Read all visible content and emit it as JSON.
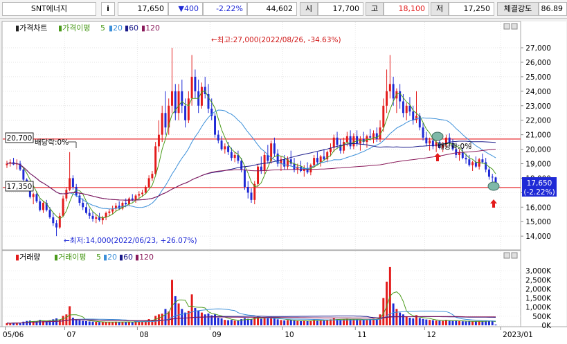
{
  "toolbar": {
    "stock_name": "SNT에너지",
    "info_icon": "i",
    "current_price": "17,650",
    "change": "▼400",
    "change_pct": "-2.22%",
    "volume": "44,602",
    "open_label": "시",
    "open": "17,700",
    "high_label": "고",
    "high": "18,100",
    "low_label": "저",
    "low": "17,250",
    "strength_label": "체결강도",
    "strength": "86.89"
  },
  "colors": {
    "up": "#e31b1b",
    "down": "#1f2ad6",
    "ma5": "#4a9a1a",
    "ma20": "#3b8fd9",
    "ma60": "#1a1a8a",
    "ma120": "#8a1a5a",
    "hline": "#e8292c",
    "background": "#ffffff"
  },
  "price_panel": {
    "legend": {
      "name": "가격차트",
      "ma_title": "가격이평",
      "ma": [
        "5",
        "20",
        "60",
        "120"
      ]
    },
    "high_annotation": "←최고:27,000(2022/08/26, -34.63%)",
    "low_annotation": "←최저:14,000(2022/06/23, +26.07%)",
    "dividend_label_1": "배당락:0%",
    "dividend_label_2": "배당락:0%",
    "level_high": "20,700",
    "level_low": "17,350",
    "current_badge_price": "17,650",
    "current_badge_pct": "(-2.22%)"
  },
  "volume_panel": {
    "legend": {
      "name": "거래량",
      "ma_title": "거래이평",
      "ma": [
        "5",
        "20",
        "60",
        "120"
      ]
    }
  },
  "x_axis": {
    "labels": [
      "05/06",
      "07",
      "08",
      "09",
      "10",
      "11",
      "12",
      "2023/01"
    ]
  },
  "chart_data": {
    "type": "candlestick",
    "price_axis": {
      "ylim": [
        13100,
        28100
      ],
      "ticks": [
        "14,000",
        "15,000",
        "16,000",
        "17,000",
        "18,000",
        "19,000",
        "20,000",
        "21,000",
        "22,000",
        "23,000",
        "24,000",
        "25,000",
        "26,000",
        "27,000"
      ]
    },
    "volume_axis": {
      "ylim": [
        0,
        3500
      ],
      "ticks": [
        "0K",
        "500K",
        "1,000K",
        "1,500K",
        "2,000K",
        "2,500K",
        "3,000K"
      ]
    },
    "horizontal_levels": [
      20700,
      17350
    ],
    "highest": {
      "value": 27000,
      "date": "2022/08/26"
    },
    "lowest": {
      "value": 14000,
      "date": "2022/06/23"
    },
    "month_starts": [
      0,
      18,
      40,
      62,
      84,
      106,
      127,
      150
    ],
    "candles": [
      {
        "o": 18900,
        "h": 19200,
        "l": 18700,
        "c": 19000,
        "v": 120
      },
      {
        "o": 19000,
        "h": 19300,
        "l": 18800,
        "c": 19100,
        "v": 110
      },
      {
        "o": 19100,
        "h": 19400,
        "l": 18900,
        "c": 18950,
        "v": 130
      },
      {
        "o": 18950,
        "h": 19300,
        "l": 18600,
        "c": 19000,
        "v": 150
      },
      {
        "o": 19000,
        "h": 19200,
        "l": 18500,
        "c": 18600,
        "v": 140
      },
      {
        "o": 18600,
        "h": 18700,
        "l": 17800,
        "c": 17900,
        "v": 200
      },
      {
        "o": 17900,
        "h": 18000,
        "l": 17200,
        "c": 17300,
        "v": 240
      },
      {
        "o": 17300,
        "h": 17400,
        "l": 16600,
        "c": 16700,
        "v": 260
      },
      {
        "o": 16700,
        "h": 17000,
        "l": 16200,
        "c": 16900,
        "v": 220
      },
      {
        "o": 16900,
        "h": 17100,
        "l": 16300,
        "c": 16400,
        "v": 210
      },
      {
        "o": 16400,
        "h": 16600,
        "l": 15700,
        "c": 15800,
        "v": 300
      },
      {
        "o": 15800,
        "h": 16400,
        "l": 15600,
        "c": 16300,
        "v": 260
      },
      {
        "o": 16300,
        "h": 16500,
        "l": 15700,
        "c": 15800,
        "v": 230
      },
      {
        "o": 15800,
        "h": 16000,
        "l": 15200,
        "c": 15300,
        "v": 280
      },
      {
        "o": 15300,
        "h": 15600,
        "l": 14700,
        "c": 14900,
        "v": 330
      },
      {
        "o": 14900,
        "h": 15100,
        "l": 14000,
        "c": 14600,
        "v": 380
      },
      {
        "o": 14600,
        "h": 15600,
        "l": 14500,
        "c": 15400,
        "v": 310
      },
      {
        "o": 15400,
        "h": 16800,
        "l": 15300,
        "c": 16600,
        "v": 520
      },
      {
        "o": 16600,
        "h": 17400,
        "l": 16400,
        "c": 17200,
        "v": 600
      },
      {
        "o": 17200,
        "h": 19800,
        "l": 17100,
        "c": 18000,
        "v": 1050
      },
      {
        "o": 18000,
        "h": 18200,
        "l": 17200,
        "c": 17400,
        "v": 420
      },
      {
        "o": 17400,
        "h": 17600,
        "l": 16700,
        "c": 16800,
        "v": 300
      },
      {
        "o": 16800,
        "h": 17000,
        "l": 16100,
        "c": 16300,
        "v": 280
      },
      {
        "o": 16300,
        "h": 16600,
        "l": 15800,
        "c": 16000,
        "v": 250
      },
      {
        "o": 16000,
        "h": 16300,
        "l": 15500,
        "c": 15600,
        "v": 230
      },
      {
        "o": 15600,
        "h": 15900,
        "l": 15200,
        "c": 15400,
        "v": 210
      },
      {
        "o": 15400,
        "h": 15700,
        "l": 15000,
        "c": 15200,
        "v": 200
      },
      {
        "o": 15200,
        "h": 15500,
        "l": 14900,
        "c": 15300,
        "v": 190
      },
      {
        "o": 15300,
        "h": 15600,
        "l": 15000,
        "c": 15100,
        "v": 180
      },
      {
        "o": 15100,
        "h": 15400,
        "l": 14800,
        "c": 15300,
        "v": 170
      },
      {
        "o": 15300,
        "h": 15700,
        "l": 15100,
        "c": 15600,
        "v": 180
      },
      {
        "o": 15600,
        "h": 15900,
        "l": 15400,
        "c": 15700,
        "v": 170
      },
      {
        "o": 15700,
        "h": 16100,
        "l": 15500,
        "c": 15900,
        "v": 190
      },
      {
        "o": 15900,
        "h": 16300,
        "l": 15700,
        "c": 16100,
        "v": 200
      },
      {
        "o": 16100,
        "h": 16400,
        "l": 15800,
        "c": 15900,
        "v": 180
      },
      {
        "o": 15900,
        "h": 16400,
        "l": 15800,
        "c": 16300,
        "v": 190
      },
      {
        "o": 16300,
        "h": 16600,
        "l": 16000,
        "c": 16200,
        "v": 180
      },
      {
        "o": 16200,
        "h": 16700,
        "l": 16100,
        "c": 16600,
        "v": 200
      },
      {
        "o": 16600,
        "h": 16900,
        "l": 16400,
        "c": 16500,
        "v": 190
      },
      {
        "o": 16500,
        "h": 16900,
        "l": 16300,
        "c": 16800,
        "v": 200
      },
      {
        "o": 16800,
        "h": 17100,
        "l": 16600,
        "c": 16900,
        "v": 210
      },
      {
        "o": 16900,
        "h": 17200,
        "l": 16700,
        "c": 17000,
        "v": 220
      },
      {
        "o": 17000,
        "h": 17500,
        "l": 16900,
        "c": 17400,
        "v": 260
      },
      {
        "o": 17400,
        "h": 18200,
        "l": 17300,
        "c": 18000,
        "v": 340
      },
      {
        "o": 18000,
        "h": 18500,
        "l": 17800,
        "c": 18300,
        "v": 300
      },
      {
        "o": 18300,
        "h": 20500,
        "l": 18200,
        "c": 20200,
        "v": 520
      },
      {
        "o": 20200,
        "h": 22000,
        "l": 19800,
        "c": 21000,
        "v": 600
      },
      {
        "o": 21000,
        "h": 23000,
        "l": 20500,
        "c": 22500,
        "v": 640
      },
      {
        "o": 22500,
        "h": 24000,
        "l": 21000,
        "c": 21500,
        "v": 900
      },
      {
        "o": 21500,
        "h": 23500,
        "l": 21000,
        "c": 23000,
        "v": 760
      },
      {
        "o": 23000,
        "h": 27000,
        "l": 22500,
        "c": 24000,
        "v": 2500
      },
      {
        "o": 24000,
        "h": 24500,
        "l": 22000,
        "c": 22500,
        "v": 1600
      },
      {
        "o": 22500,
        "h": 24500,
        "l": 22000,
        "c": 24000,
        "v": 1200
      },
      {
        "o": 24000,
        "h": 24800,
        "l": 22500,
        "c": 23000,
        "v": 900
      },
      {
        "o": 23000,
        "h": 23500,
        "l": 21500,
        "c": 22000,
        "v": 700
      },
      {
        "o": 22000,
        "h": 24000,
        "l": 21800,
        "c": 23500,
        "v": 800
      },
      {
        "o": 23500,
        "h": 26500,
        "l": 23000,
        "c": 25000,
        "v": 1700
      },
      {
        "o": 25000,
        "h": 25500,
        "l": 23500,
        "c": 24000,
        "v": 950
      },
      {
        "o": 24000,
        "h": 24800,
        "l": 22500,
        "c": 23000,
        "v": 800
      },
      {
        "o": 23000,
        "h": 24600,
        "l": 22800,
        "c": 24300,
        "v": 700
      },
      {
        "o": 24300,
        "h": 25000,
        "l": 23500,
        "c": 23800,
        "v": 600
      },
      {
        "o": 23800,
        "h": 24500,
        "l": 22500,
        "c": 22800,
        "v": 650
      },
      {
        "o": 22800,
        "h": 23500,
        "l": 22000,
        "c": 22300,
        "v": 550
      },
      {
        "o": 22300,
        "h": 22500,
        "l": 20800,
        "c": 21000,
        "v": 600
      },
      {
        "o": 21000,
        "h": 21300,
        "l": 20400,
        "c": 20600,
        "v": 420
      },
      {
        "o": 20600,
        "h": 20900,
        "l": 19900,
        "c": 20000,
        "v": 380
      },
      {
        "o": 20000,
        "h": 20400,
        "l": 19700,
        "c": 20200,
        "v": 300
      },
      {
        "o": 20200,
        "h": 20500,
        "l": 19600,
        "c": 19800,
        "v": 280
      },
      {
        "o": 19800,
        "h": 20100,
        "l": 19200,
        "c": 19400,
        "v": 300
      },
      {
        "o": 19400,
        "h": 19800,
        "l": 19100,
        "c": 19600,
        "v": 260
      },
      {
        "o": 19600,
        "h": 19900,
        "l": 19000,
        "c": 19200,
        "v": 250
      },
      {
        "o": 19200,
        "h": 19400,
        "l": 18400,
        "c": 18600,
        "v": 340
      },
      {
        "o": 18600,
        "h": 18800,
        "l": 17200,
        "c": 17400,
        "v": 400
      },
      {
        "o": 17400,
        "h": 17800,
        "l": 16600,
        "c": 17000,
        "v": 360
      },
      {
        "o": 17000,
        "h": 17300,
        "l": 16300,
        "c": 16500,
        "v": 330
      },
      {
        "o": 16500,
        "h": 17800,
        "l": 16200,
        "c": 17600,
        "v": 420
      },
      {
        "o": 17600,
        "h": 19000,
        "l": 17400,
        "c": 18800,
        "v": 480
      },
      {
        "o": 18800,
        "h": 19500,
        "l": 18300,
        "c": 18500,
        "v": 360
      },
      {
        "o": 18500,
        "h": 19800,
        "l": 18300,
        "c": 19600,
        "v": 420
      },
      {
        "o": 19600,
        "h": 20300,
        "l": 19000,
        "c": 19200,
        "v": 380
      },
      {
        "o": 19200,
        "h": 20600,
        "l": 19000,
        "c": 20400,
        "v": 460
      },
      {
        "o": 20400,
        "h": 20800,
        "l": 19500,
        "c": 19700,
        "v": 380
      },
      {
        "o": 19700,
        "h": 20000,
        "l": 18800,
        "c": 19000,
        "v": 330
      },
      {
        "o": 19000,
        "h": 19500,
        "l": 18500,
        "c": 19300,
        "v": 290
      },
      {
        "o": 19300,
        "h": 19600,
        "l": 18600,
        "c": 18800,
        "v": 270
      },
      {
        "o": 18800,
        "h": 19500,
        "l": 18600,
        "c": 19300,
        "v": 280
      },
      {
        "o": 19300,
        "h": 19900,
        "l": 18800,
        "c": 19000,
        "v": 300
      },
      {
        "o": 19000,
        "h": 19400,
        "l": 18400,
        "c": 18600,
        "v": 260
      },
      {
        "o": 18600,
        "h": 19000,
        "l": 18300,
        "c": 18800,
        "v": 240
      },
      {
        "o": 18800,
        "h": 19200,
        "l": 18400,
        "c": 18500,
        "v": 230
      },
      {
        "o": 18500,
        "h": 18900,
        "l": 18100,
        "c": 18700,
        "v": 250
      },
      {
        "o": 18700,
        "h": 19100,
        "l": 18300,
        "c": 18400,
        "v": 240
      },
      {
        "o": 18400,
        "h": 19000,
        "l": 18200,
        "c": 18900,
        "v": 260
      },
      {
        "o": 18900,
        "h": 19600,
        "l": 18700,
        "c": 19400,
        "v": 300
      },
      {
        "o": 19400,
        "h": 19800,
        "l": 18900,
        "c": 19100,
        "v": 280
      },
      {
        "o": 19100,
        "h": 19600,
        "l": 18800,
        "c": 19500,
        "v": 270
      },
      {
        "o": 19500,
        "h": 20000,
        "l": 19200,
        "c": 19300,
        "v": 260
      },
      {
        "o": 19300,
        "h": 19900,
        "l": 19100,
        "c": 19800,
        "v": 290
      },
      {
        "o": 19800,
        "h": 20400,
        "l": 19500,
        "c": 20100,
        "v": 330
      },
      {
        "o": 20100,
        "h": 21000,
        "l": 19800,
        "c": 20800,
        "v": 380
      },
      {
        "o": 20800,
        "h": 21200,
        "l": 20100,
        "c": 20300,
        "v": 340
      },
      {
        "o": 20300,
        "h": 20700,
        "l": 19700,
        "c": 19900,
        "v": 300
      },
      {
        "o": 19900,
        "h": 20800,
        "l": 19700,
        "c": 20500,
        "v": 320
      },
      {
        "o": 20500,
        "h": 21200,
        "l": 20200,
        "c": 20900,
        "v": 360
      },
      {
        "o": 20900,
        "h": 21300,
        "l": 20000,
        "c": 20200,
        "v": 330
      },
      {
        "o": 20200,
        "h": 21100,
        "l": 20000,
        "c": 20900,
        "v": 340
      },
      {
        "o": 20900,
        "h": 21300,
        "l": 20200,
        "c": 20400,
        "v": 320
      },
      {
        "o": 20400,
        "h": 20900,
        "l": 19900,
        "c": 20700,
        "v": 300
      },
      {
        "o": 20700,
        "h": 21200,
        "l": 20300,
        "c": 20500,
        "v": 310
      },
      {
        "o": 20500,
        "h": 21000,
        "l": 20100,
        "c": 20900,
        "v": 320
      },
      {
        "o": 20900,
        "h": 21400,
        "l": 20600,
        "c": 20800,
        "v": 340
      },
      {
        "o": 20800,
        "h": 21300,
        "l": 20400,
        "c": 21100,
        "v": 360
      },
      {
        "o": 21100,
        "h": 21500,
        "l": 20500,
        "c": 20700,
        "v": 350
      },
      {
        "o": 20700,
        "h": 22000,
        "l": 20500,
        "c": 21500,
        "v": 600
      },
      {
        "o": 21500,
        "h": 23500,
        "l": 21200,
        "c": 23000,
        "v": 1500
      },
      {
        "o": 23000,
        "h": 25500,
        "l": 22500,
        "c": 24000,
        "v": 2400
      },
      {
        "o": 24000,
        "h": 26500,
        "l": 23500,
        "c": 24500,
        "v": 3200
      },
      {
        "o": 24500,
        "h": 25000,
        "l": 23000,
        "c": 23500,
        "v": 1200
      },
      {
        "o": 23500,
        "h": 24200,
        "l": 22500,
        "c": 24000,
        "v": 900
      },
      {
        "o": 24000,
        "h": 24500,
        "l": 22800,
        "c": 23300,
        "v": 700
      },
      {
        "o": 23300,
        "h": 23800,
        "l": 22200,
        "c": 22500,
        "v": 600
      },
      {
        "o": 22500,
        "h": 23200,
        "l": 22000,
        "c": 23000,
        "v": 500
      },
      {
        "o": 23000,
        "h": 23600,
        "l": 22300,
        "c": 22600,
        "v": 420
      },
      {
        "o": 22600,
        "h": 23000,
        "l": 21700,
        "c": 22000,
        "v": 380
      },
      {
        "o": 22000,
        "h": 24000,
        "l": 21800,
        "c": 22300,
        "v": 560
      },
      {
        "o": 22300,
        "h": 22500,
        "l": 21300,
        "c": 21500,
        "v": 400
      },
      {
        "o": 21500,
        "h": 21800,
        "l": 20600,
        "c": 20800,
        "v": 350
      },
      {
        "o": 20800,
        "h": 21200,
        "l": 20200,
        "c": 20400,
        "v": 320
      },
      {
        "o": 20400,
        "h": 20800,
        "l": 19900,
        "c": 20600,
        "v": 300
      },
      {
        "o": 20600,
        "h": 21000,
        "l": 20000,
        "c": 20200,
        "v": 280
      },
      {
        "o": 20200,
        "h": 20700,
        "l": 19800,
        "c": 20500,
        "v": 260
      },
      {
        "o": 20500,
        "h": 20900,
        "l": 20000,
        "c": 20100,
        "v": 250
      },
      {
        "o": 20100,
        "h": 20500,
        "l": 19800,
        "c": 20300,
        "v": 240
      },
      {
        "o": 20300,
        "h": 21000,
        "l": 20100,
        "c": 20800,
        "v": 300
      },
      {
        "o": 20800,
        "h": 21100,
        "l": 20200,
        "c": 20400,
        "v": 260
      },
      {
        "o": 20400,
        "h": 20700,
        "l": 19900,
        "c": 20000,
        "v": 240
      },
      {
        "o": 20000,
        "h": 20400,
        "l": 19400,
        "c": 19600,
        "v": 260
      },
      {
        "o": 19600,
        "h": 20000,
        "l": 19200,
        "c": 19800,
        "v": 230
      },
      {
        "o": 19800,
        "h": 20100,
        "l": 19300,
        "c": 19400,
        "v": 220
      },
      {
        "o": 19400,
        "h": 19700,
        "l": 19000,
        "c": 19300,
        "v": 210
      },
      {
        "o": 19300,
        "h": 19600,
        "l": 18800,
        "c": 18900,
        "v": 230
      },
      {
        "o": 18900,
        "h": 19200,
        "l": 18500,
        "c": 19100,
        "v": 220
      },
      {
        "o": 19100,
        "h": 19500,
        "l": 18700,
        "c": 18800,
        "v": 210
      },
      {
        "o": 18800,
        "h": 19400,
        "l": 18600,
        "c": 19300,
        "v": 230
      },
      {
        "o": 19300,
        "h": 19700,
        "l": 19000,
        "c": 19100,
        "v": 220
      },
      {
        "o": 19100,
        "h": 19400,
        "l": 18400,
        "c": 18600,
        "v": 240
      },
      {
        "o": 18600,
        "h": 18800,
        "l": 17900,
        "c": 18100,
        "v": 260
      },
      {
        "o": 18100,
        "h": 18300,
        "l": 17600,
        "c": 18050,
        "v": 230
      },
      {
        "o": 18050,
        "h": 18100,
        "l": 17250,
        "c": 17650,
        "v": 45
      }
    ]
  }
}
